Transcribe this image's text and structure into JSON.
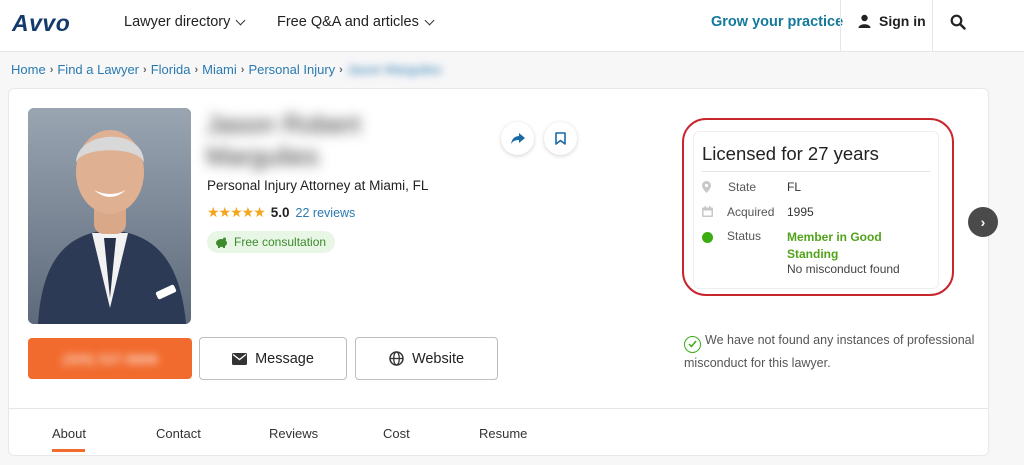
{
  "header": {
    "logo": "Avvo",
    "nav": [
      {
        "label": "Lawyer directory"
      },
      {
        "label": "Free Q&A and articles"
      }
    ],
    "grow": "Grow your practice",
    "sign_in": "Sign in",
    "icons": [
      "chevron-down-icon",
      "user-icon",
      "search-icon"
    ]
  },
  "breadcrumb": [
    "Home",
    "Find a Lawyer",
    "Florida",
    "Miami",
    "Personal Injury",
    "Jason Margulies"
  ],
  "profile": {
    "name": "Jason Robert Margulies",
    "title": "Personal Injury Attorney at Miami, FL",
    "stars": "★★★★★",
    "rating": "5.0",
    "reviews": "22 reviews",
    "free_consultation": "Free consultation",
    "phone": "(305) 537-8888",
    "message_label": "Message",
    "website_label": "Website"
  },
  "license": {
    "title": "Licensed for 27 years",
    "rows": [
      {
        "label": "State",
        "value": "FL",
        "icon": "location-pin-icon"
      },
      {
        "label": "Acquired",
        "value": "1995",
        "icon": "calendar-icon"
      },
      {
        "label": "Status",
        "value": "Member in Good Standing",
        "icon": "status-dot-icon"
      }
    ],
    "misconduct": "No misconduct found",
    "highlight_color": "#c9252c"
  },
  "notice": "We have not found any instances of professional misconduct for this lawyer.",
  "tabs": [
    "About",
    "Contact",
    "Reviews",
    "Cost",
    "Resume"
  ],
  "colors": {
    "brand": "#143a6b",
    "accent": "#f26b2e",
    "link": "#2a7ab0",
    "good": "#52a31b"
  }
}
